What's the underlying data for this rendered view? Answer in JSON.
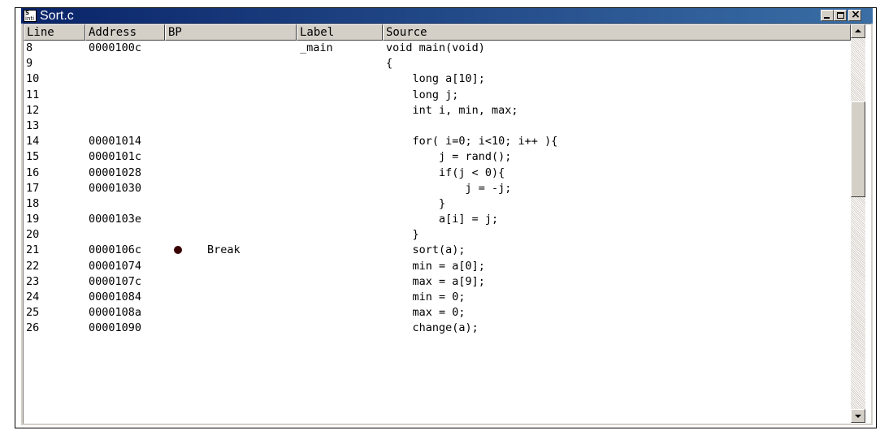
{
  "window": {
    "title": "Sort.c",
    "icon_text_top": "S",
    "icon_text_bottom": "inti",
    "controls": [
      "minimize-icon",
      "maximize-icon",
      "close-icon"
    ]
  },
  "columns": {
    "line": "Line",
    "address": "Address",
    "bp": "BP",
    "label": "Label",
    "source": "Source"
  },
  "rows": [
    {
      "line": "8",
      "address": "0000100c",
      "bp": "",
      "label": "_main",
      "source": "void main(void)"
    },
    {
      "line": "9",
      "address": "",
      "bp": "",
      "label": "",
      "source": "{"
    },
    {
      "line": "10",
      "address": "",
      "bp": "",
      "label": "",
      "source": "    long a[10];"
    },
    {
      "line": "11",
      "address": "",
      "bp": "",
      "label": "",
      "source": "    long j;"
    },
    {
      "line": "12",
      "address": "",
      "bp": "",
      "label": "",
      "source": "    int i, min, max;"
    },
    {
      "line": "13",
      "address": "",
      "bp": "",
      "label": "",
      "source": ""
    },
    {
      "line": "14",
      "address": "00001014",
      "bp": "",
      "label": "",
      "source": "    for( i=0; i<10; i++ ){"
    },
    {
      "line": "15",
      "address": "0000101c",
      "bp": "",
      "label": "",
      "source": "        j = rand();"
    },
    {
      "line": "16",
      "address": "00001028",
      "bp": "",
      "label": "",
      "source": "        if(j < 0){"
    },
    {
      "line": "17",
      "address": "00001030",
      "bp": "",
      "label": "",
      "source": "            j = -j;"
    },
    {
      "line": "18",
      "address": "",
      "bp": "",
      "label": "",
      "source": "        }"
    },
    {
      "line": "19",
      "address": "0000103e",
      "bp": "",
      "label": "",
      "source": "        a[i] = j;"
    },
    {
      "line": "20",
      "address": "",
      "bp": "",
      "label": "",
      "source": "    }"
    },
    {
      "line": "21",
      "address": "0000106c",
      "bp": "Break",
      "label": "",
      "source": "    sort(a);"
    },
    {
      "line": "22",
      "address": "00001074",
      "bp": "",
      "label": "",
      "source": "    min = a[0];"
    },
    {
      "line": "23",
      "address": "0000107c",
      "bp": "",
      "label": "",
      "source": "    max = a[9];"
    },
    {
      "line": "24",
      "address": "00001084",
      "bp": "",
      "label": "",
      "source": "    min = 0;"
    },
    {
      "line": "25",
      "address": "0000108a",
      "bp": "",
      "label": "",
      "source": "    max = 0;"
    },
    {
      "line": "26",
      "address": "00001090",
      "bp": "",
      "label": "",
      "source": "    change(a);"
    }
  ],
  "breakpoint_marker": {
    "icon": "breakpoint-dot-icon",
    "color": "#3a0000"
  },
  "colors": {
    "titlebar_start": "#0a246a",
    "titlebar_end": "#3a6ea5",
    "face": "#d4d0c8"
  }
}
